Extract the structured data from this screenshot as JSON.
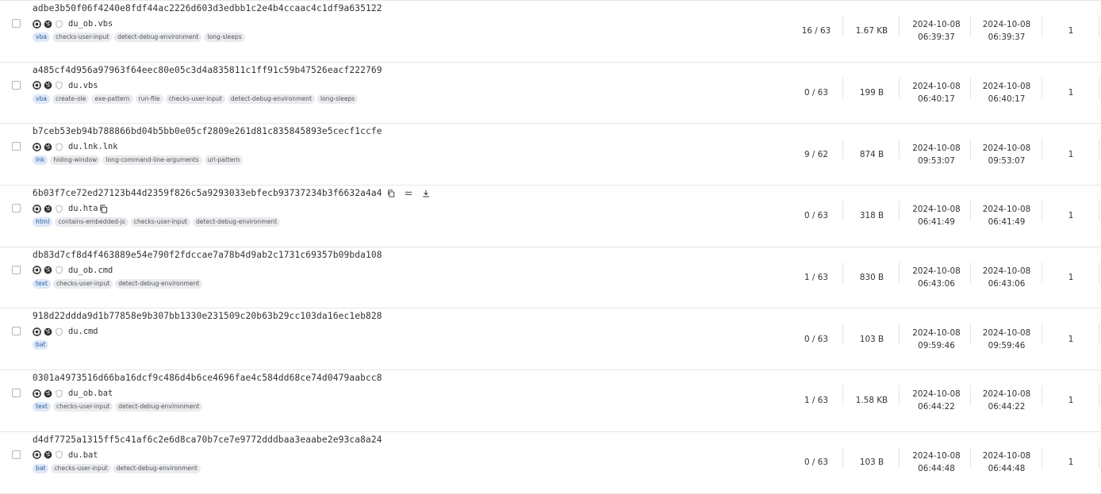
{
  "rows": [
    {
      "sha256": "adbe3b50f06f4240e8fdf44ac2226d603d3edbb1c2e4b4ccaac4c1df9a635122",
      "name": "du_ob.vbs",
      "tags": [
        {
          "label": "vba",
          "type": true
        },
        {
          "label": "checks-user-input"
        },
        {
          "label": "detect-debug-environment"
        },
        {
          "label": "long-sleeps"
        }
      ],
      "detections": "16 / 63",
      "size": "1.67 KB",
      "first_seen_date": "2024-10-08",
      "first_seen_time": "06:39:37",
      "last_seen_date": "2024-10-08",
      "last_seen_time": "06:39:37",
      "submitters": "1"
    },
    {
      "sha256": "a485cf4d956a97963f64eec80e05c3d4a835811c1ff91c59b47526eacf222769",
      "name": "du.vbs",
      "tags": [
        {
          "label": "vba",
          "type": true
        },
        {
          "label": "create-ole"
        },
        {
          "label": "exe-pattern"
        },
        {
          "label": "run-file"
        },
        {
          "label": "checks-user-input"
        },
        {
          "label": "detect-debug-environment"
        },
        {
          "label": "long-sleeps"
        }
      ],
      "detections": "0 / 63",
      "size": "199 B",
      "first_seen_date": "2024-10-08",
      "first_seen_time": "06:40:17",
      "last_seen_date": "2024-10-08",
      "last_seen_time": "06:40:17",
      "submitters": "1"
    },
    {
      "sha256": "b7ceb53eb94b788866bd04b5bb0e05cf2809e261d81c835845893e5cecf1ccfe",
      "name": "du.lnk.lnk",
      "tags": [
        {
          "label": "lnk",
          "type": true
        },
        {
          "label": "hiding-window"
        },
        {
          "label": "long-command-line-arguments"
        },
        {
          "label": "url-pattern"
        }
      ],
      "detections": "9 / 62",
      "size": "874 B",
      "first_seen_date": "2024-10-08",
      "first_seen_time": "09:53:07",
      "last_seen_date": "2024-10-08",
      "last_seen_time": "09:53:07",
      "submitters": "1"
    },
    {
      "sha256": "6b03f7ce72ed27123b44d2359f826c5a9293033ebfecb93737234b3f6632a4a4",
      "name": "du.hta",
      "hovered": true,
      "tags": [
        {
          "label": "html",
          "type": true
        },
        {
          "label": "contains-embedded-js"
        },
        {
          "label": "checks-user-input"
        },
        {
          "label": "detect-debug-environment"
        }
      ],
      "detections": "0 / 63",
      "size": "318 B",
      "first_seen_date": "2024-10-08",
      "first_seen_time": "06:41:49",
      "last_seen_date": "2024-10-08",
      "last_seen_time": "06:41:49",
      "submitters": "1"
    },
    {
      "sha256": "db83d7cf8d4f463889e54e790f2fdccae7a78b4d9ab2c1731c69357b09bda108",
      "name": "du_ob.cmd",
      "tags": [
        {
          "label": "text",
          "type": true
        },
        {
          "label": "checks-user-input"
        },
        {
          "label": "detect-debug-environment"
        }
      ],
      "detections": "1 / 63",
      "size": "830 B",
      "first_seen_date": "2024-10-08",
      "first_seen_time": "06:43:06",
      "last_seen_date": "2024-10-08",
      "last_seen_time": "06:43:06",
      "submitters": "1"
    },
    {
      "sha256": "918d22ddda9d1b77858e9b307bb1330e231509c20b63b29cc103da16ec1eb828",
      "name": "du.cmd",
      "tags": [
        {
          "label": "bat",
          "type": true
        }
      ],
      "detections": "0 / 63",
      "size": "103 B",
      "first_seen_date": "2024-10-08",
      "first_seen_time": "09:59:46",
      "last_seen_date": "2024-10-08",
      "last_seen_time": "09:59:46",
      "submitters": "1"
    },
    {
      "sha256": "0301a4973516d66ba16dcf9c486d4b6ce4696fae4c584dd68ce74d0479aabcc8",
      "name": "du_ob.bat",
      "tags": [
        {
          "label": "text",
          "type": true
        },
        {
          "label": "checks-user-input"
        },
        {
          "label": "detect-debug-environment"
        }
      ],
      "detections": "1 / 63",
      "size": "1.58 KB",
      "first_seen_date": "2024-10-08",
      "first_seen_time": "06:44:22",
      "last_seen_date": "2024-10-08",
      "last_seen_time": "06:44:22",
      "submitters": "1"
    },
    {
      "sha256": "d4df7725a1315ff5c41af6c2e6d8ca70b7ce7e9772dddbaa3eaabe2e93ca8a24",
      "name": "du.bat",
      "tags": [
        {
          "label": "bat",
          "type": true
        },
        {
          "label": "checks-user-input"
        },
        {
          "label": "detect-debug-environment"
        }
      ],
      "detections": "0 / 63",
      "size": "103 B",
      "first_seen_date": "2024-10-08",
      "first_seen_time": "06:44:48",
      "last_seen_date": "2024-10-08",
      "last_seen_time": "06:44:48",
      "submitters": "1"
    }
  ],
  "icons": {
    "row_prefix": [
      "target-icon",
      "globe-icon",
      "shield-outline-icon"
    ],
    "hover_actions": [
      "copy-icon",
      "compare-icon",
      "download-icon"
    ],
    "name_copy": "copy-icon"
  },
  "colors": {
    "type_tag_bg": "#dde8f8",
    "type_tag_text": "#2d5c9b",
    "tag_bg": "#e9ebee"
  }
}
